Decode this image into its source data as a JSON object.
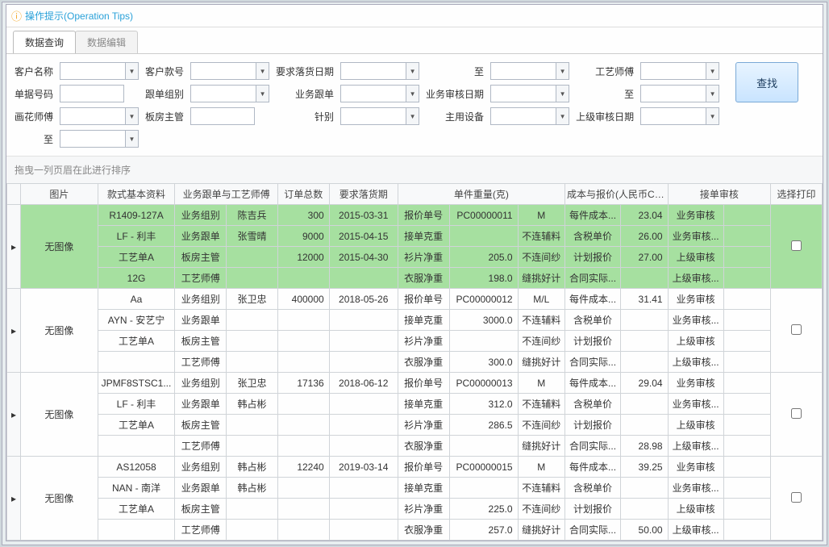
{
  "tips": {
    "icon_label": "info-icon",
    "text": "操作提示(Operation Tips)"
  },
  "tabs": [
    {
      "label": "数据查询",
      "active": true
    },
    {
      "label": "数据编辑",
      "active": false
    }
  ],
  "filters": {
    "rows": [
      [
        {
          "label": "客户名称",
          "type": "combo"
        },
        {
          "label": "客户款号",
          "type": "combo"
        },
        {
          "label": "要求落货日期",
          "type": "combo"
        },
        {
          "label": "至",
          "type": "combo",
          "to": true
        },
        {
          "label": "工艺师傅",
          "type": "combo"
        },
        {
          "label": "单据号码",
          "type": "text"
        }
      ],
      [
        {
          "label": "跟单组别",
          "type": "combo"
        },
        {
          "label": "业务跟单",
          "type": "combo"
        },
        {
          "label": "业务审核日期",
          "type": "combo"
        },
        {
          "label": "至",
          "type": "combo",
          "to": true
        },
        {
          "label": "画花师傅",
          "type": "combo"
        },
        {
          "label": "板房主管",
          "type": "text"
        }
      ],
      [
        {
          "label": "针别",
          "type": "combo"
        },
        {
          "label": "主用设备",
          "type": "combo"
        },
        {
          "label": "上级审核日期",
          "type": "combo"
        },
        {
          "label": "至",
          "type": "combo",
          "to": true
        }
      ]
    ]
  },
  "search_label": "查找",
  "group_hint": "拖曳一列页眉在此进行排序",
  "headers": {
    "exp": "",
    "pic": "图片",
    "style": "款式基本资料",
    "biz1": "业务跟单与工艺师傅",
    "biz2": "",
    "qty": "订单总数",
    "date": "要求落货期",
    "uw1": "单件重量(克)",
    "uw2": "",
    "uw3": "",
    "cost1": "成本与报价(人民币CNY)",
    "cost2": "",
    "aud1": "接单审核",
    "aud2": "",
    "print": "选择打印"
  },
  "col_widths": {
    "exp": 16,
    "pic": 90,
    "style": 90,
    "biz1": 60,
    "biz2": 60,
    "qty": 60,
    "date": 80,
    "uw1": 60,
    "uw2": 80,
    "uw3": 55,
    "cost1": 65,
    "cost2": 55,
    "aud1": 65,
    "aud2": 55,
    "print": 60
  },
  "groups": [
    {
      "highlight": true,
      "pic": "无图像",
      "rows": [
        {
          "style": "R1409-127A",
          "b1": "业务组别",
          "b2": "陈吉兵",
          "qty": "300",
          "date": "2015-03-31",
          "u1": "报价单号",
          "u2": "PC00000011",
          "u3": "M",
          "c1": "每件成本...",
          "c2": "23.04",
          "a1": "业务审核",
          "a2": ""
        },
        {
          "style": "LF - 利丰",
          "b1": "业务跟单",
          "b2": "张雪晴",
          "qty": "9000",
          "date": "2015-04-15",
          "u1": "接单克重",
          "u2": "",
          "u3": "不连辅料",
          "c1": "含税单价",
          "c2": "26.00",
          "a1": "业务审核...",
          "a2": ""
        },
        {
          "style": "工艺单A",
          "b1": "板房主管",
          "b2": "",
          "qty": "12000",
          "date": "2015-04-30",
          "u1": "衫片净重",
          "u2": "205.0",
          "u3": "不连间纱",
          "c1": "计划报价",
          "c2": "27.00",
          "a1": "上级审核",
          "a2": ""
        },
        {
          "style": "12G",
          "b1": "工艺师傅",
          "b2": "",
          "qty": "",
          "date": "",
          "u1": "衣服净重",
          "u2": "198.0",
          "u3": "缝挑好计",
          "c1": "合同实际...",
          "c2": "",
          "a1": "上级审核...",
          "a2": ""
        }
      ]
    },
    {
      "pic": "无图像",
      "rows": [
        {
          "style": "Aa",
          "b1": "业务组别",
          "b2": "张卫忠",
          "qty": "400000",
          "date": "2018-05-26",
          "u1": "报价单号",
          "u2": "PC00000012",
          "u3": "M/L",
          "c1": "每件成本...",
          "c2": "31.41",
          "a1": "业务审核",
          "a2": ""
        },
        {
          "style": "AYN - 安艺宁",
          "b1": "业务跟单",
          "b2": "",
          "qty": "",
          "date": "",
          "u1": "接单克重",
          "u2": "3000.0",
          "u3": "不连辅料",
          "c1": "含税单价",
          "c2": "",
          "a1": "业务审核...",
          "a2": ""
        },
        {
          "style": "工艺单A",
          "b1": "板房主管",
          "b2": "",
          "qty": "",
          "date": "",
          "u1": "衫片净重",
          "u2": "",
          "u3": "不连间纱",
          "c1": "计划报价",
          "c2": "",
          "a1": "上级审核",
          "a2": ""
        },
        {
          "style": "",
          "b1": "工艺师傅",
          "b2": "",
          "qty": "",
          "date": "",
          "u1": "衣服净重",
          "u2": "300.0",
          "u3": "缝挑好计",
          "c1": "合同实际...",
          "c2": "",
          "a1": "上级审核...",
          "a2": ""
        }
      ]
    },
    {
      "pic": "无图像",
      "rows": [
        {
          "style": "JPMF8STSC1...",
          "b1": "业务组别",
          "b2": "张卫忠",
          "qty": "17136",
          "date": "2018-06-12",
          "u1": "报价单号",
          "u2": "PC00000013",
          "u3": "M",
          "c1": "每件成本...",
          "c2": "29.04",
          "a1": "业务审核",
          "a2": ""
        },
        {
          "style": "LF - 利丰",
          "b1": "业务跟单",
          "b2": "韩占彬",
          "qty": "",
          "date": "",
          "u1": "接单克重",
          "u2": "312.0",
          "u3": "不连辅料",
          "c1": "含税单价",
          "c2": "",
          "a1": "业务审核...",
          "a2": ""
        },
        {
          "style": "工艺单A",
          "b1": "板房主管",
          "b2": "",
          "qty": "",
          "date": "",
          "u1": "衫片净重",
          "u2": "286.5",
          "u3": "不连间纱",
          "c1": "计划报价",
          "c2": "",
          "a1": "上级审核",
          "a2": ""
        },
        {
          "style": "",
          "b1": "工艺师傅",
          "b2": "",
          "qty": "",
          "date": "",
          "u1": "衣服净重",
          "u2": "",
          "u3": "缝挑好计",
          "c1": "合同实际...",
          "c2": "28.98",
          "a1": "上级审核...",
          "a2": ""
        }
      ]
    },
    {
      "pic": "无图像",
      "rows": [
        {
          "style": "AS12058",
          "b1": "业务组别",
          "b2": "韩占彬",
          "qty": "12240",
          "date": "2019-03-14",
          "u1": "报价单号",
          "u2": "PC00000015",
          "u3": "M",
          "c1": "每件成本...",
          "c2": "39.25",
          "a1": "业务审核",
          "a2": ""
        },
        {
          "style": "NAN - 南洋",
          "b1": "业务跟单",
          "b2": "韩占彬",
          "qty": "",
          "date": "",
          "u1": "接单克重",
          "u2": "",
          "u3": "不连辅料",
          "c1": "含税单价",
          "c2": "",
          "a1": "业务审核...",
          "a2": ""
        },
        {
          "style": "工艺单A",
          "b1": "板房主管",
          "b2": "",
          "qty": "",
          "date": "",
          "u1": "衫片净重",
          "u2": "225.0",
          "u3": "不连间纱",
          "c1": "计划报价",
          "c2": "",
          "a1": "上级审核",
          "a2": ""
        },
        {
          "style": "",
          "b1": "工艺师傅",
          "b2": "",
          "qty": "",
          "date": "",
          "u1": "衣服净重",
          "u2": "257.0",
          "u3": "缝挑好计",
          "c1": "合同实际...",
          "c2": "50.00",
          "a1": "上级审核...",
          "a2": ""
        }
      ]
    }
  ]
}
